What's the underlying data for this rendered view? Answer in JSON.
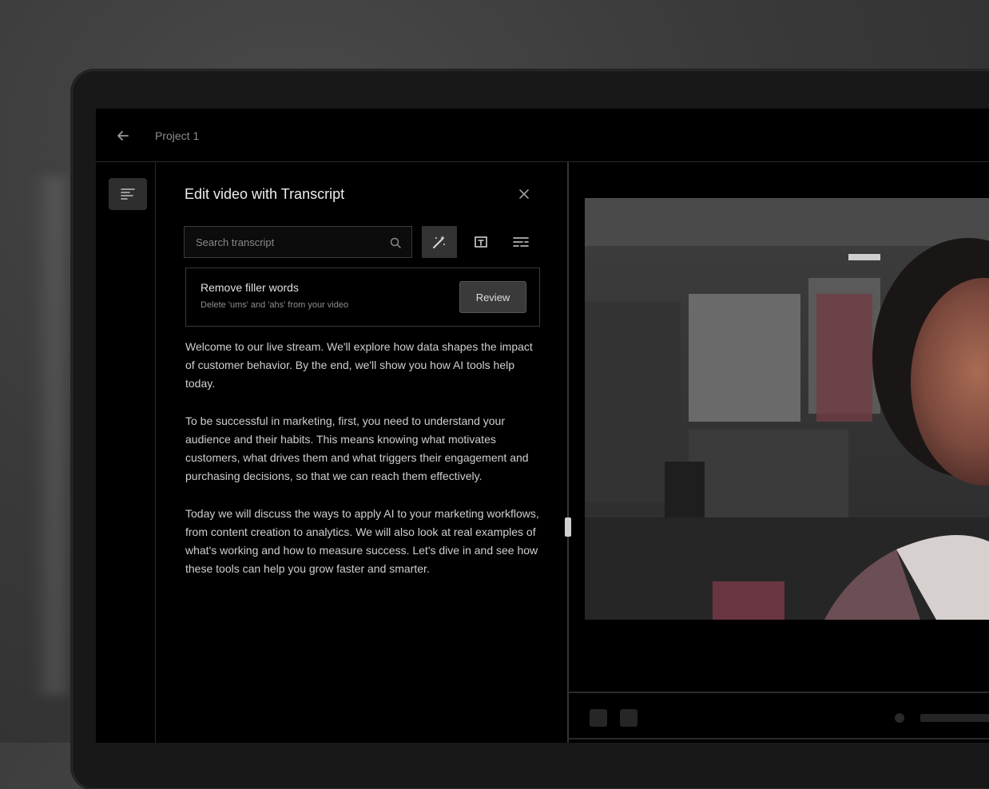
{
  "header": {
    "project_name": "Project 1"
  },
  "panel": {
    "title": "Edit video with Transcript",
    "search_placeholder": "Search transcript",
    "tools": [
      {
        "name": "magic-wand-icon",
        "active": true
      },
      {
        "name": "text-align-icon",
        "active": false
      },
      {
        "name": "captions-icon",
        "active": false
      }
    ]
  },
  "banner": {
    "title": "Remove filler words",
    "description": "Delete 'ums' and 'ahs' from your video",
    "button_label": "Review"
  },
  "transcript": {
    "paragraphs": [
      "Welcome to our live stream. We'll explore how data shapes the impact of customer behavior. By the end, we'll show you how AI tools help today.",
      "To be successful in marketing, first, you need to understand your audience and their habits. This means knowing what motivates customers, what drives them and what triggers their engagement and purchasing decisions, so that we can reach them effectively.",
      "Today we will discuss the ways to apply AI to your marketing workflows, from content creation to analytics. We will also look at real examples of what's working and how to measure success. Let's dive in and see how these tools can help you grow faster and smarter."
    ]
  },
  "colors": {
    "background": "#000000",
    "accent_button": "#3a3a3a",
    "handle": "#d0d0d0"
  }
}
